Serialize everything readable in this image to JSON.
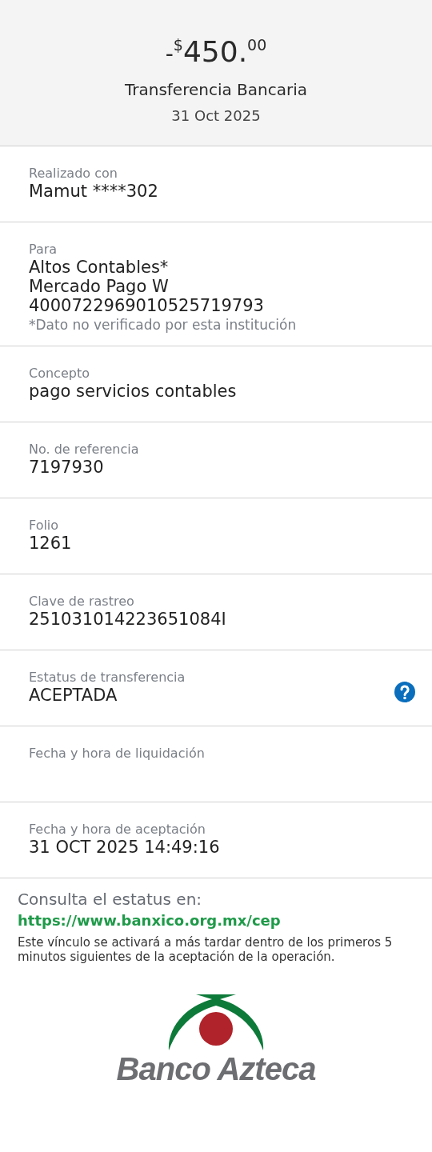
{
  "header": {
    "amount": {
      "sign": "-",
      "currency": "$",
      "integer": "450.",
      "cents": "00"
    },
    "title": "Transferencia Bancaria",
    "date": "31 Oct 2025"
  },
  "fields": [
    {
      "label": "Realizado con",
      "lines": [
        "Mamut ****302"
      ]
    },
    {
      "label": "Para",
      "lines": [
        "Altos Contables*",
        "Mercado Pago W",
        "4000722969010525719793"
      ],
      "note": "*Dato no verificado por esta institución"
    },
    {
      "label": "Concepto",
      "lines": [
        "pago servicios contables"
      ]
    },
    {
      "label": "No. de referencia",
      "lines": [
        "7197930"
      ]
    },
    {
      "label": "Folio",
      "lines": [
        "1261"
      ]
    },
    {
      "label": "Clave de rastreo",
      "lines": [
        "251031014223651084I"
      ]
    },
    {
      "label": "Estatus de transferencia",
      "lines": [
        "ACEPTADA"
      ],
      "help": true
    },
    {
      "label": "Fecha y hora de liquidación"
    },
    {
      "label": "Fecha y hora de aceptación",
      "lines": [
        "31 OCT 2025 14:49:16"
      ]
    }
  ],
  "footer": {
    "heading": "Consulta el estatus en:",
    "link": "https://www.banxico.org.mx/cep",
    "note": "Este vínculo se activará a más tardar dentro de los primeros 5 minutos siguientes de la aceptación de la operación."
  },
  "logo": {
    "name": "Banco Azteca"
  }
}
